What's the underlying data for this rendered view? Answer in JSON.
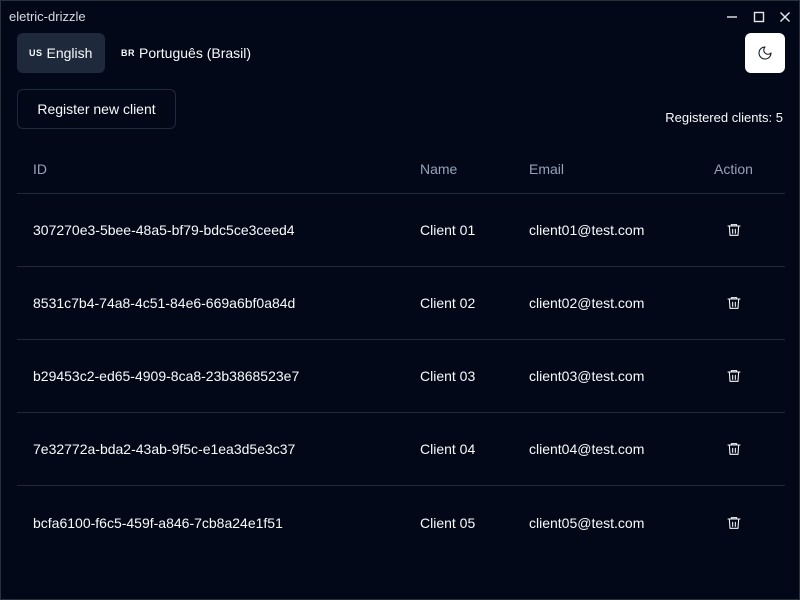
{
  "window": {
    "title": "eletric-drizzle"
  },
  "languages": [
    {
      "flag": "US",
      "label": "English",
      "active": true
    },
    {
      "flag": "BR",
      "label": "Português (Brasil)",
      "active": false
    }
  ],
  "toolbar": {
    "register_label": "Register new client",
    "count_text": "Registered clients: 5"
  },
  "table": {
    "headers": {
      "id": "ID",
      "name": "Name",
      "email": "Email",
      "action": "Action"
    },
    "rows": [
      {
        "id": "307270e3-5bee-48a5-bf79-bdc5ce3ceed4",
        "name": "Client 01",
        "email": "client01@test.com"
      },
      {
        "id": "8531c7b4-74a8-4c51-84e6-669a6bf0a84d",
        "name": "Client 02",
        "email": "client02@test.com"
      },
      {
        "id": "b29453c2-ed65-4909-8ca8-23b3868523e7",
        "name": "Client 03",
        "email": "client03@test.com"
      },
      {
        "id": "7e32772a-bda2-43ab-9f5c-e1ea3d5e3c37",
        "name": "Client 04",
        "email": "client04@test.com"
      },
      {
        "id": "bcfa6100-f6c5-459f-a846-7cb8a24e1f51",
        "name": "Client 05",
        "email": "client05@test.com"
      }
    ]
  },
  "icons": {
    "minimize": "minimize-icon",
    "maximize": "maximize-icon",
    "close": "close-icon",
    "theme": "moon-icon",
    "delete": "trash-icon"
  },
  "colors": {
    "background": "#020817",
    "border": "#1e293b",
    "active_tab": "#1e293b",
    "header_text": "#94a3b8",
    "theme_button": "#ffffff"
  }
}
